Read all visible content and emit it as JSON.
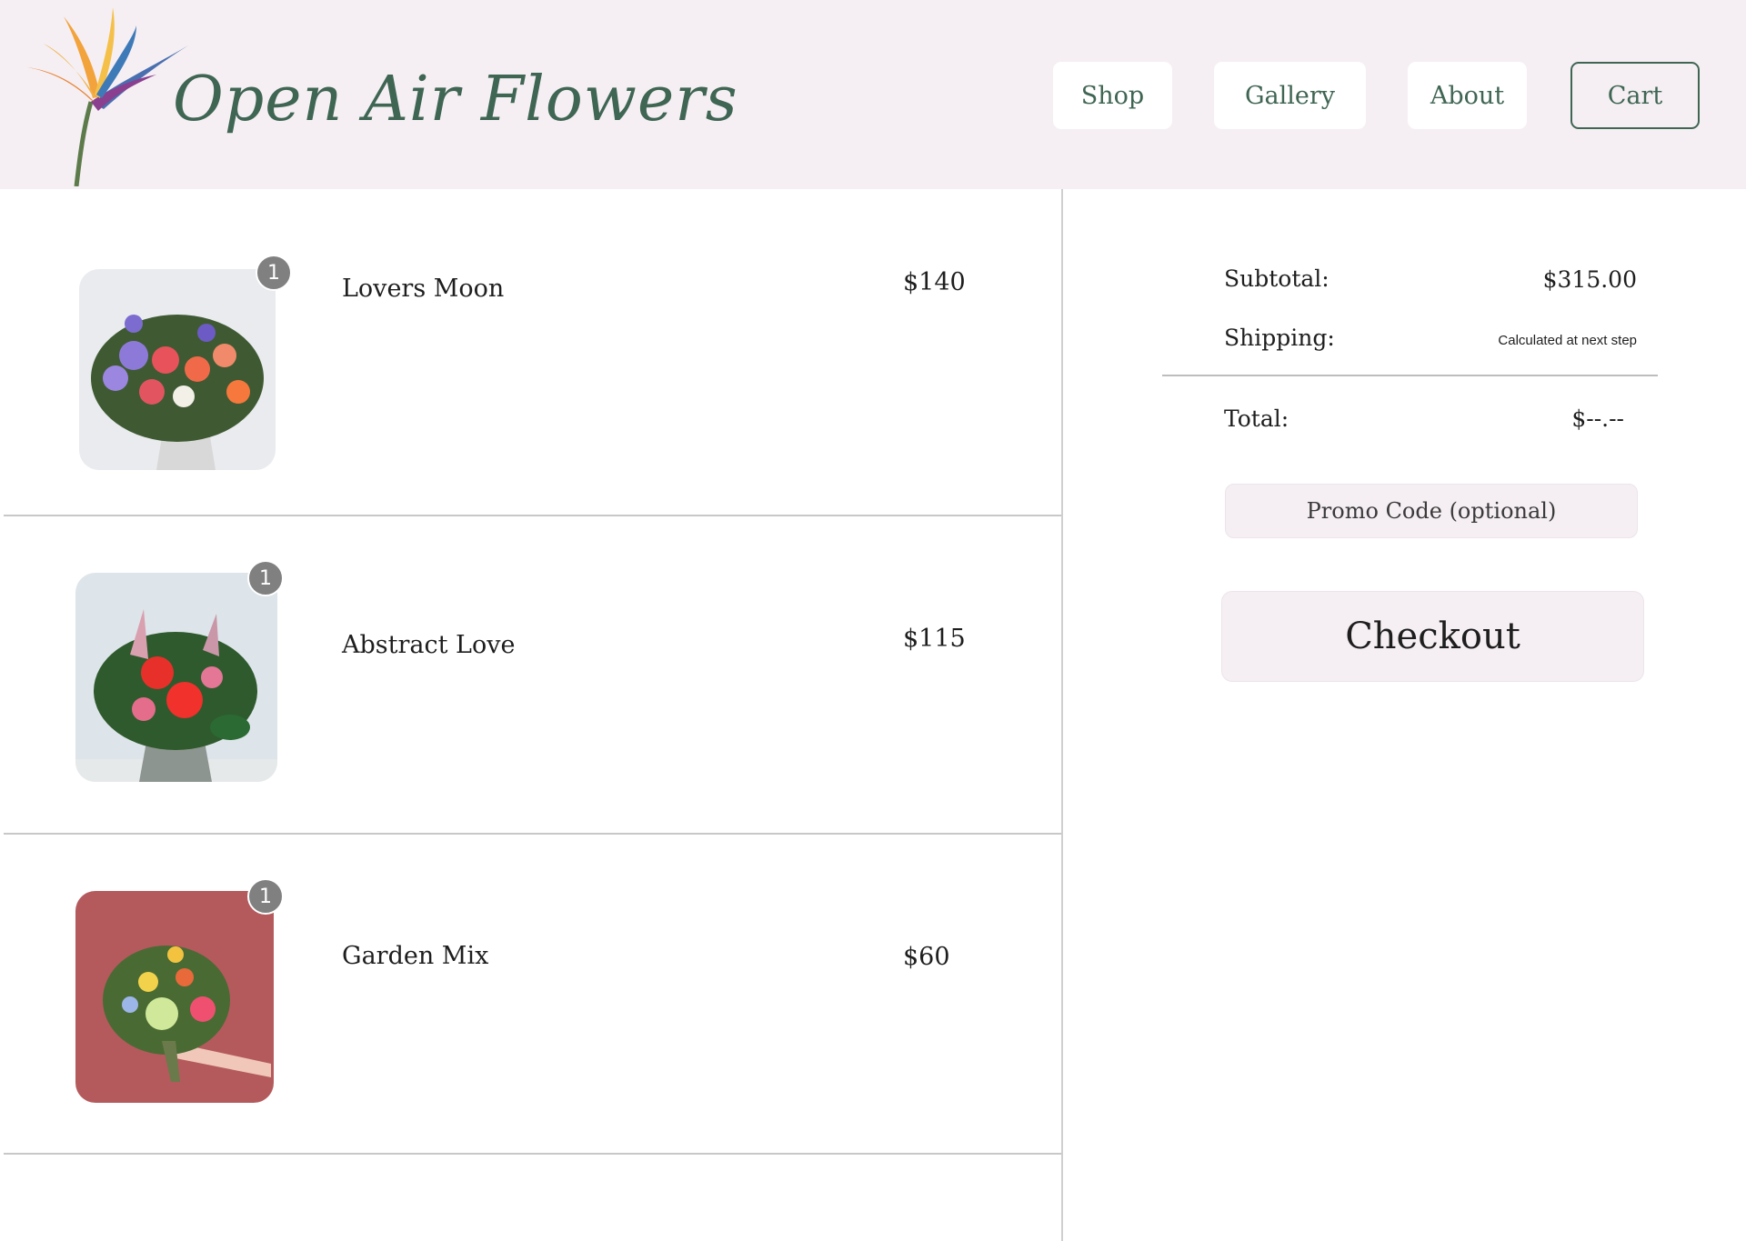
{
  "brand": {
    "name": "Open Air Flowers",
    "logo_icon": "bird-of-paradise-flower-icon",
    "color": "#3f6553",
    "header_bg": "#f5eff3"
  },
  "nav": {
    "shop": "Shop",
    "gallery": "Gallery",
    "about": "About",
    "cart": "Cart"
  },
  "cart": {
    "items": [
      {
        "name": "Lovers Moon",
        "price": "$140",
        "quantity": "1",
        "image": "colorful-bouquet-photo"
      },
      {
        "name": "Abstract Love",
        "price": "$115",
        "quantity": "1",
        "image": "red-anthurium-bouquet-photo"
      },
      {
        "name": "Garden Mix",
        "price": "$60",
        "quantity": "1",
        "image": "garden-bouquet-on-red-wall-photo"
      }
    ]
  },
  "summary": {
    "subtotal_label": "Subtotal:",
    "subtotal_value": "$315.00",
    "shipping_label": "Shipping:",
    "shipping_value": "Calculated at next step",
    "total_label": "Total:",
    "total_value": "$--.--",
    "promo_placeholder": "Promo Code (optional)",
    "checkout_label": "Checkout"
  }
}
